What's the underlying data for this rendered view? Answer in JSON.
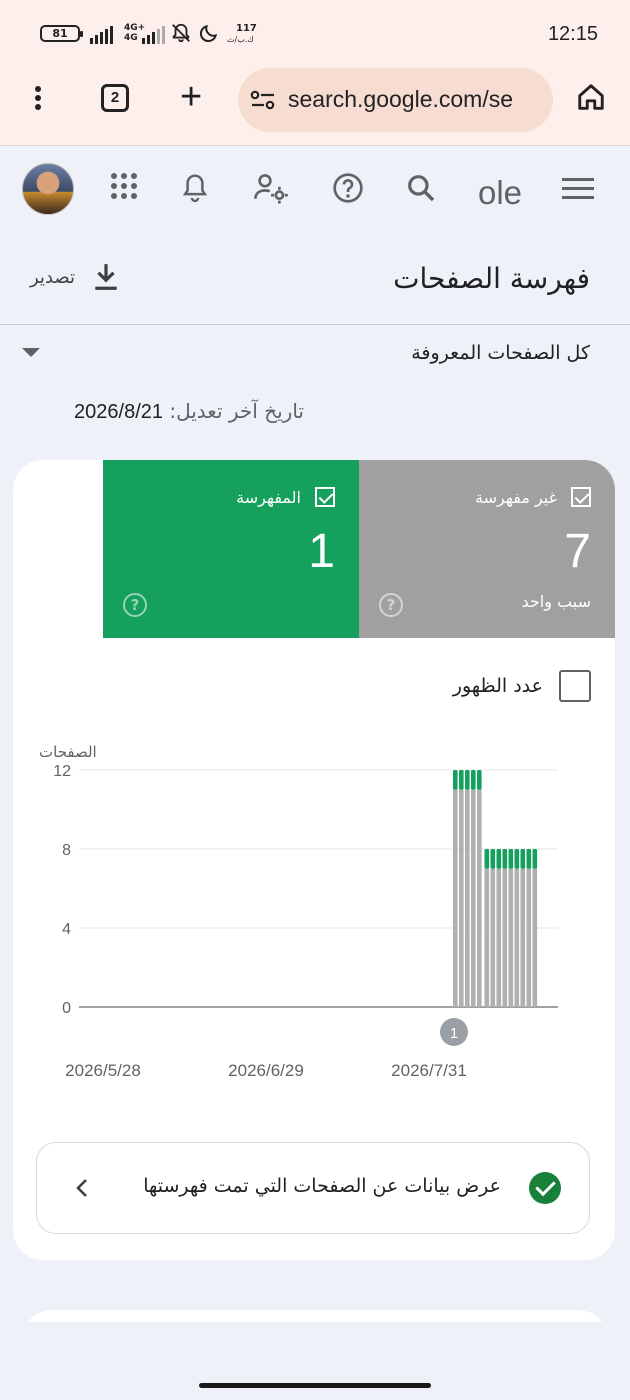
{
  "status_bar": {
    "battery": "81",
    "network": "4G+",
    "network2": "4G",
    "speed_value": "117",
    "speed_unit": "ك.ب/ث",
    "time": "12:15"
  },
  "browser": {
    "tab_count": "2",
    "url": "search.google.com/se"
  },
  "header": {
    "logo_partial": "ole"
  },
  "page": {
    "title": "فهرسة الصفحات",
    "export_label": "تصدير",
    "filter_label": "كل الصفحات المعروفة",
    "updated_label": "تاريخ آخر تعديل:",
    "updated_date": "2026/8/21"
  },
  "tiles": {
    "not_indexed": {
      "label": "غير مفهرسة",
      "count": "7",
      "sub": "سبب واحد",
      "color": "#a0a0a0"
    },
    "indexed": {
      "label": "المفهرسة",
      "count": "1",
      "color": "#16a05d"
    }
  },
  "impressions_label": "عدد الظهور",
  "chart_data": {
    "type": "bar",
    "stacked": true,
    "ylabel": "الصفحات",
    "y_ticks": [
      0,
      4,
      8,
      12
    ],
    "ylim": [
      0,
      12
    ],
    "x_tick_labels": [
      "2026/5/28",
      "2026/6/29",
      "2026/7/31"
    ],
    "annotation": "1",
    "series": [
      {
        "name": "غير مفهرسة",
        "color": "#b0b0b0",
        "values": [
          11,
          11,
          11,
          11,
          11,
          7,
          7,
          7,
          7,
          7,
          7,
          7,
          7,
          7
        ]
      },
      {
        "name": "المفهرسة",
        "color": "#16a05d",
        "values": [
          1,
          1,
          1,
          1,
          1,
          1,
          1,
          1,
          1,
          1,
          1,
          1,
          1,
          1
        ]
      }
    ]
  },
  "view_row": {
    "label": "عرض بيانات عن الصفحات التي تمت فهرستها"
  }
}
